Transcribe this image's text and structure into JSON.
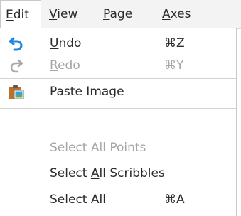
{
  "menubar": {
    "items": [
      {
        "label": "Edit",
        "mnemonic_index": 0
      },
      {
        "label": "View",
        "mnemonic_index": 0
      },
      {
        "label": "Page",
        "mnemonic_index": 0
      },
      {
        "label": "Axes",
        "mnemonic_index": 0
      }
    ],
    "active": "Edit"
  },
  "edit_menu": {
    "undo": {
      "pre": "",
      "mn": "U",
      "post": "ndo",
      "shortcut": "⌘Z",
      "icon": "undo-icon",
      "enabled": true
    },
    "redo": {
      "pre": "",
      "mn": "R",
      "post": "edo",
      "shortcut": "⌘Y",
      "icon": "redo-icon",
      "enabled": false
    },
    "paste_image": {
      "pre": "",
      "mn": "P",
      "post": "aste Image",
      "icon": "paste-image-icon",
      "enabled": true
    },
    "select_all_points": {
      "pre": "Select All ",
      "mn": "P",
      "post": "oints",
      "enabled": false
    },
    "select_all_scribbles": {
      "pre": "Select ",
      "mn": "A",
      "post": "ll Scribbles",
      "enabled": true
    },
    "select_all": {
      "pre": "",
      "mn": "S",
      "post": "elect All",
      "shortcut": "⌘A",
      "enabled": true
    }
  },
  "colors": {
    "undo_icon": "#1e88e5",
    "redo_icon_disabled": "#a9a9a9",
    "clipboard": "#b8722c",
    "image_blue": "#3aa0e0",
    "image_green": "#5fb050"
  }
}
